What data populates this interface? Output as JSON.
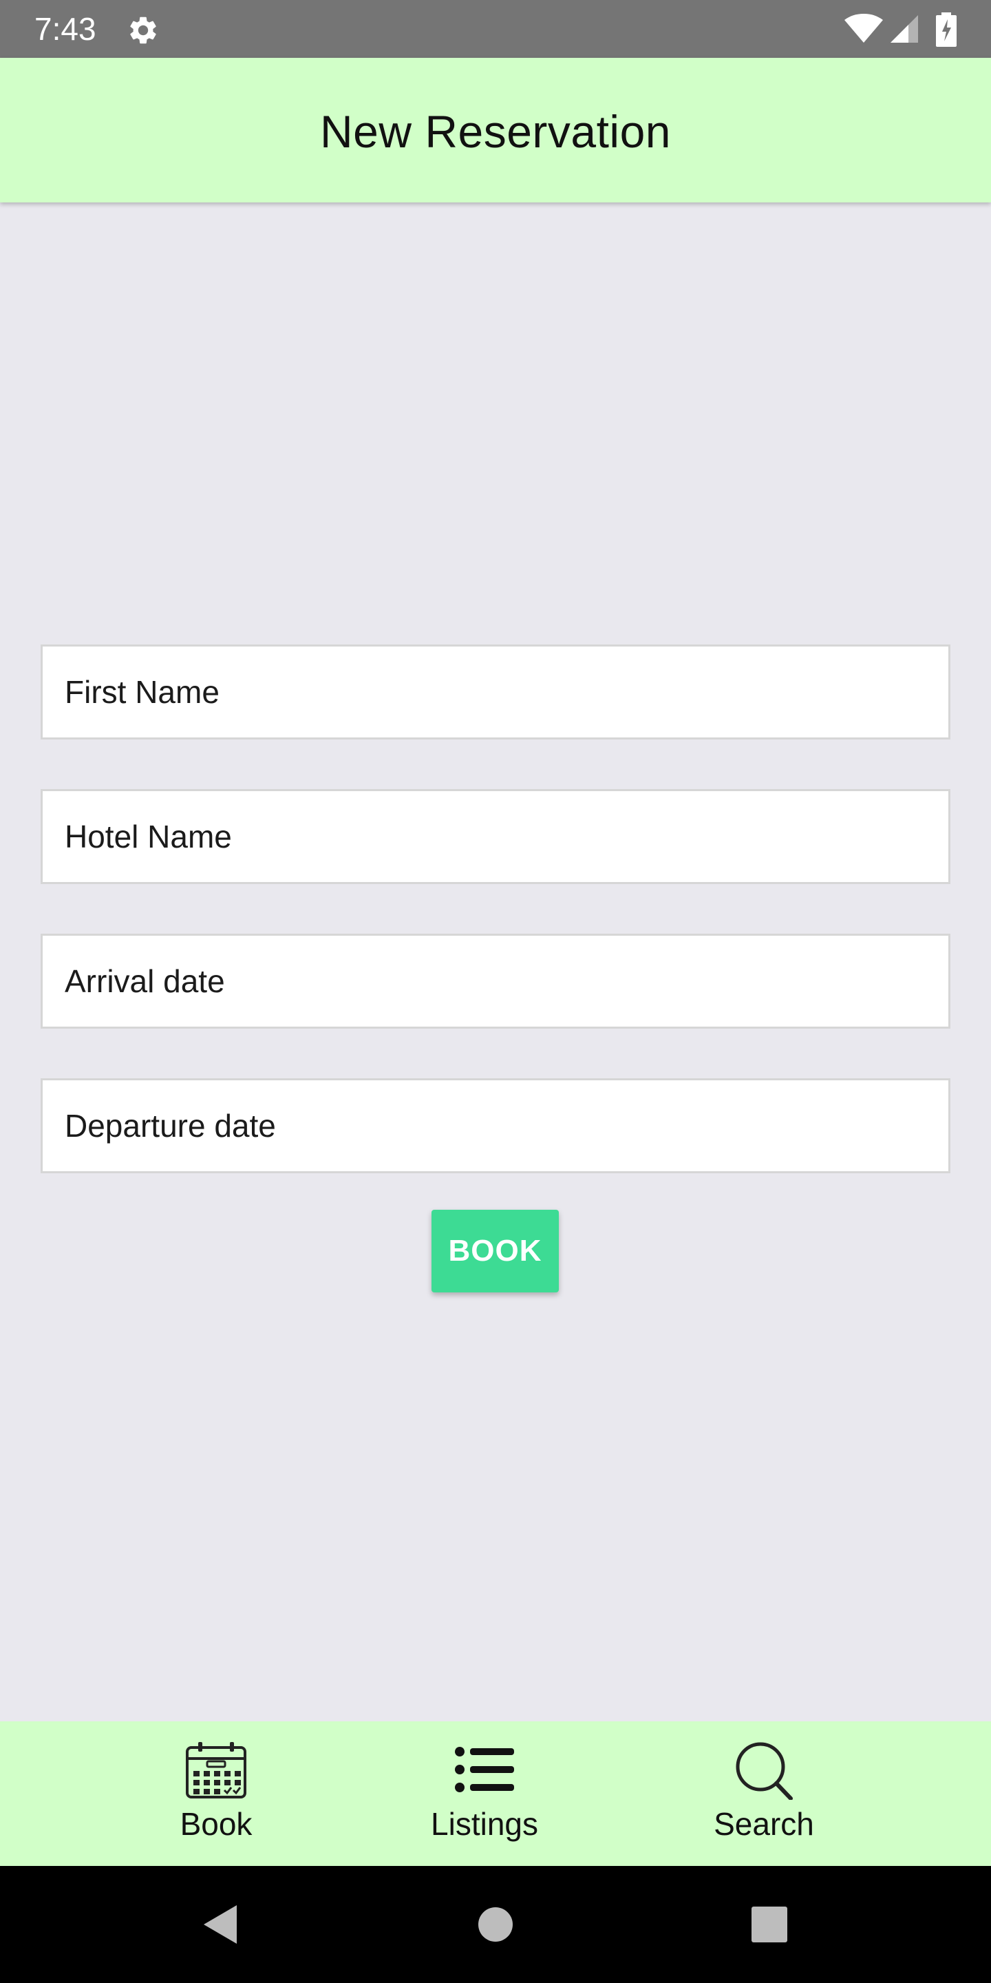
{
  "status_bar": {
    "time": "7:43",
    "icons": [
      "settings-gear-icon",
      "wifi-icon",
      "signal-icon",
      "battery-charging-icon"
    ]
  },
  "app_bar": {
    "title": "New Reservation",
    "background": "#d1ffc8"
  },
  "form": {
    "fields": [
      {
        "placeholder": "First Name",
        "value": ""
      },
      {
        "placeholder": "Hotel Name",
        "value": ""
      },
      {
        "placeholder": "Arrival date",
        "value": ""
      },
      {
        "placeholder": "Departure date",
        "value": ""
      }
    ],
    "submit_label": "BOOK",
    "submit_color": "#3ddb94"
  },
  "bottom_nav": {
    "items": [
      {
        "label": "Book",
        "icon": "calendar-icon"
      },
      {
        "label": "Listings",
        "icon": "list-icon"
      },
      {
        "label": "Search",
        "icon": "search-icon"
      }
    ]
  },
  "system_nav": {
    "icons": [
      "back-icon",
      "home-icon",
      "recents-icon"
    ]
  }
}
